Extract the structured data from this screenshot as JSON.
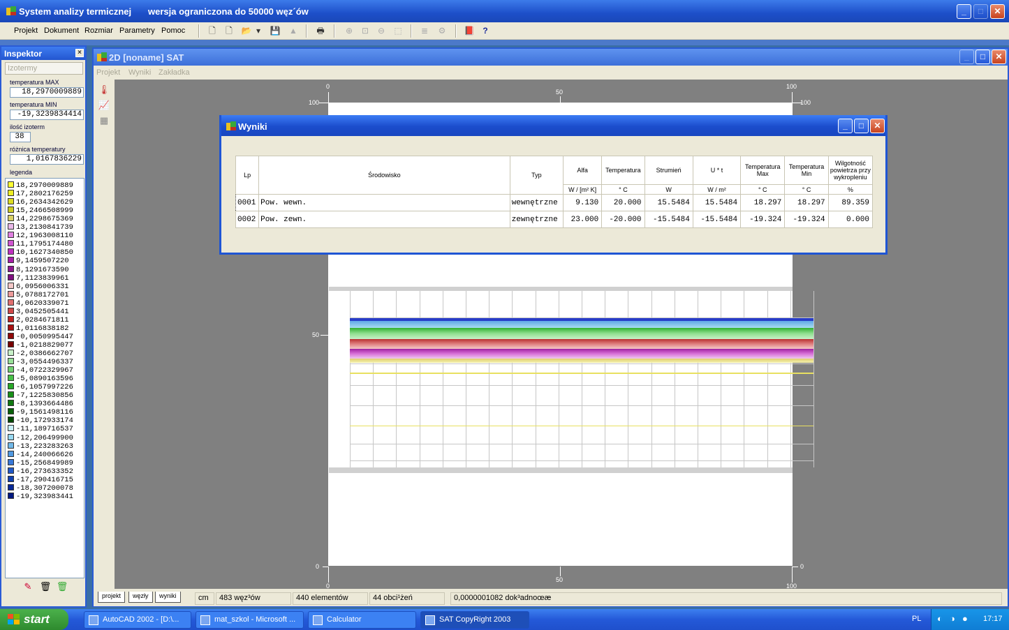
{
  "app": {
    "title": "System analizy termicznej",
    "subtitle": "wersja ograniczona do 50000 węz´ów"
  },
  "menu": [
    "Projekt",
    "Dokument",
    "Rozmiar",
    "Parametry",
    "Pomoc"
  ],
  "inspector": {
    "title": "Inspektor",
    "close": "×",
    "tab": "Izotermy",
    "fields": [
      {
        "label": "temperatura MAX",
        "value": "18,2970009889"
      },
      {
        "label": "temperatura MIN",
        "value": "-19,3239834414"
      },
      {
        "label": "ilość izoterm",
        "value": "38"
      },
      {
        "label": "różnica temperatury",
        "value": "1,0167836229"
      }
    ],
    "legend_label": "legenda",
    "legend": [
      {
        "v": "18,2970009889",
        "c": "#ffff33"
      },
      {
        "v": "17,2802176259",
        "c": "#eeee22"
      },
      {
        "v": "16,2634342629",
        "c": "#dddd22"
      },
      {
        "v": "15,2466508999",
        "c": "#cccc22"
      },
      {
        "v": "14,2298675369",
        "c": "#d8d066"
      },
      {
        "v": "13,2130841739",
        "c": "#e8b8e8"
      },
      {
        "v": "12,1963008110",
        "c": "#e080e0"
      },
      {
        "v": "11,1795174480",
        "c": "#d055d0"
      },
      {
        "v": "10,1627340850",
        "c": "#c030c0"
      },
      {
        "v": "9,1459507220",
        "c": "#a81ea8"
      },
      {
        "v": "8,1291673590",
        "c": "#901890"
      },
      {
        "v": "7,1123839961",
        "c": "#801080"
      },
      {
        "v": "6,0956006331",
        "c": "#f4c8c8"
      },
      {
        "v": "5,0788172701",
        "c": "#ec9a9a"
      },
      {
        "v": "4,0620339071",
        "c": "#e07070"
      },
      {
        "v": "3,0452505441",
        "c": "#d04848"
      },
      {
        "v": "2,0284671811",
        "c": "#c02020"
      },
      {
        "v": "1,0116838182",
        "c": "#a81010"
      },
      {
        "v": "-0,0050995447",
        "c": "#900808"
      },
      {
        "v": "-1,0218829077",
        "c": "#780000"
      },
      {
        "v": "-2,0386662707",
        "c": "#c8f0c8"
      },
      {
        "v": "-3,0554496337",
        "c": "#98e098"
      },
      {
        "v": "-4,0722329967",
        "c": "#70d070"
      },
      {
        "v": "-5,0890163596",
        "c": "#48c048"
      },
      {
        "v": "-6,1057997226",
        "c": "#28a828"
      },
      {
        "v": "-7,1225830856",
        "c": "#189018"
      },
      {
        "v": "-8,1393664486",
        "c": "#107810"
      },
      {
        "v": "-9,1561498116",
        "c": "#086008"
      },
      {
        "v": "-10,172933174",
        "c": "#004800"
      },
      {
        "v": "-11,189716537",
        "c": "#c8f0f8"
      },
      {
        "v": "-12,206499900",
        "c": "#98d8f0"
      },
      {
        "v": "-13,223283263",
        "c": "#70b8e8"
      },
      {
        "v": "-14,240066626",
        "c": "#5098e0"
      },
      {
        "v": "-15,256849989",
        "c": "#3878d8"
      },
      {
        "v": "-16,273633352",
        "c": "#2058c8"
      },
      {
        "v": "-17,290416715",
        "c": "#1040b0"
      },
      {
        "v": "-18,307200078",
        "c": "#082898"
      },
      {
        "v": "-19,323983441",
        "c": "#001880"
      }
    ]
  },
  "window": {
    "title": "2D  [noname]  SAT",
    "menu": [
      "Projekt",
      "Wyniki",
      "Zakładka"
    ]
  },
  "axes": {
    "top": [
      "0",
      "50",
      "100"
    ],
    "left": [
      "100",
      "50",
      "0"
    ],
    "right": [
      "100",
      "50",
      "0"
    ],
    "bottom": [
      "0",
      "50",
      "100"
    ]
  },
  "tabs": [
    "projekt",
    "węzły",
    "wyniki"
  ],
  "status": [
    "cm",
    "483 węz³ów",
    "440 elementów",
    "44 obci¹żeń",
    "0,0000001082 dok³adnoœæ"
  ],
  "dialog": {
    "title": "Wyniki",
    "headers": [
      "Lp",
      "Środowisko",
      "Typ",
      "Alfa",
      "Temperatura",
      "Strumień",
      "U * t",
      "Temperatura Max",
      "Temperatura Min",
      "Wilgotność powietrza przy wykropleniu"
    ],
    "units": [
      "W / [m² K]",
      "° C",
      "W",
      "W / m²",
      "° C",
      "° C",
      "%"
    ],
    "rows": [
      [
        "0001",
        "Pow. wewn.",
        "wewnętrzne",
        "9.130",
        "20.000",
        "15.5484",
        "15.5484",
        "18.297",
        "18.297",
        "89.359"
      ],
      [
        "0002",
        "Pow. zewn.",
        "zewnętrzne",
        "23.000",
        "-20.000",
        "-15.5484",
        "-15.5484",
        "-19.324",
        "-19.324",
        "0.000"
      ]
    ]
  },
  "taskbar": {
    "start": "start",
    "tasks": [
      "AutoCAD 2002 - [D:\\...",
      "mat_szkol - Microsoft ...",
      "Calculator",
      "SAT CopyRight 2003"
    ],
    "lang": "PL",
    "clock": "17:17"
  }
}
